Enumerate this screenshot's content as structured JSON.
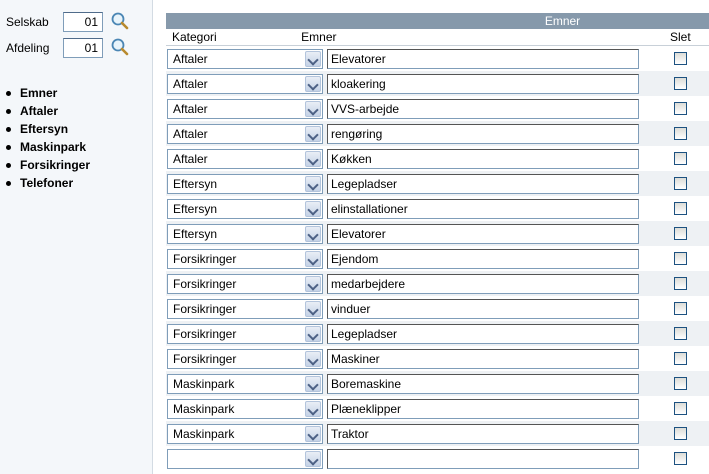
{
  "sidebar": {
    "selskab_label": "Selskab",
    "selskab_value": "01",
    "afdeling_label": "Afdeling",
    "afdeling_value": "01",
    "nav_items": [
      "Emner",
      "Aftaler",
      "Eftersyn",
      "Maskinpark",
      "Forsikringer",
      "Telefoner"
    ]
  },
  "table": {
    "title": "Emner",
    "col_kategori": "Kategori",
    "col_emner": "Emner",
    "col_slet": "Slet",
    "rows": [
      {
        "kategori": "Aftaler",
        "emne": "Elevatorer"
      },
      {
        "kategori": "Aftaler",
        "emne": "kloakering"
      },
      {
        "kategori": "Aftaler",
        "emne": "VVS-arbejde"
      },
      {
        "kategori": "Aftaler",
        "emne": "rengøring"
      },
      {
        "kategori": "Aftaler",
        "emne": "Køkken"
      },
      {
        "kategori": "Eftersyn",
        "emne": "Legepladser"
      },
      {
        "kategori": "Eftersyn",
        "emne": "elinstallationer"
      },
      {
        "kategori": "Eftersyn",
        "emne": "Elevatorer"
      },
      {
        "kategori": "Forsikringer",
        "emne": "Ejendom"
      },
      {
        "kategori": "Forsikringer",
        "emne": "medarbejdere"
      },
      {
        "kategori": "Forsikringer",
        "emne": "vinduer"
      },
      {
        "kategori": "Forsikringer",
        "emne": "Legepladser"
      },
      {
        "kategori": "Forsikringer",
        "emne": "Maskiner"
      },
      {
        "kategori": "Maskinpark",
        "emne": "Boremaskine"
      },
      {
        "kategori": "Maskinpark",
        "emne": "Plæneklipper"
      },
      {
        "kategori": "Maskinpark",
        "emne": "Traktor"
      },
      {
        "kategori": "",
        "emne": ""
      }
    ]
  }
}
